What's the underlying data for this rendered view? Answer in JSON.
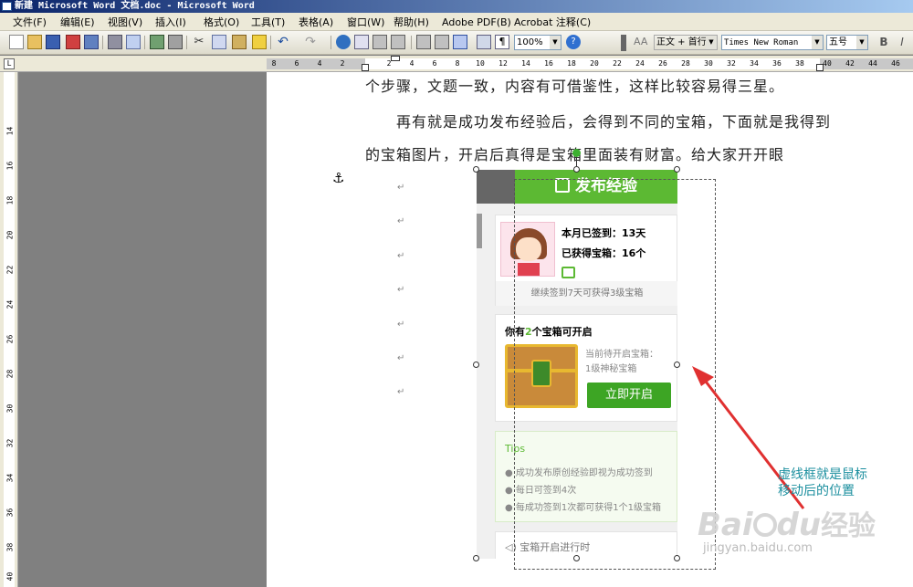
{
  "window": {
    "title": "新建 Microsoft Word 文档.doc - Microsoft Word"
  },
  "menu": {
    "items": [
      "文件(F)",
      "编辑(E)",
      "视图(V)",
      "插入(I)",
      "格式(O)",
      "工具(T)",
      "表格(A)",
      "窗口(W)",
      "帮助(H)",
      "Adobe PDF(B)",
      "Acrobat 注释(C)"
    ]
  },
  "toolbar": {
    "zoom": "100%",
    "style": "正文 + 首行",
    "font": "Times New Roman",
    "size": "五号",
    "bold": "B",
    "italic": "I"
  },
  "ruler": {
    "h_ticks": [
      "8",
      "6",
      "4",
      "2",
      "2",
      "4",
      "6",
      "8",
      "10",
      "12",
      "14",
      "16",
      "18",
      "20",
      "22",
      "24",
      "26",
      "28",
      "30",
      "32",
      "34",
      "36",
      "38",
      "40",
      "42",
      "44",
      "46"
    ],
    "v_ticks": [
      "14",
      "16",
      "18",
      "20",
      "22",
      "24",
      "26",
      "28",
      "30",
      "32",
      "34",
      "36",
      "38",
      "40"
    ]
  },
  "document": {
    "line1": "个步骤，文题一致，内容有可借鉴性，这样比较容易得三星。",
    "line2": "再有就是成功发布经验后，会得到不同的宝箱，下面就是我得到",
    "line3": "的宝箱图片，开启后真得是宝箱里面装有财富。给大家开开眼",
    "para_mark": "↵",
    "anchor": "⚓"
  },
  "picture": {
    "header": "发布经验",
    "signed_label": "本月已签到：",
    "signed_value": "13天",
    "chests_label": "已获得宝箱：",
    "chests_value": "16个",
    "continue_text": "继续签到7天可获得3级宝箱",
    "open_prefix": "你有",
    "open_count": "2",
    "open_suffix": "个宝箱可开启",
    "pending_label": "当前待开启宝箱：",
    "pending_value": "1级神秘宝箱",
    "open_button": "立即开启",
    "tips_title": "Tips",
    "tips": [
      "成功发布原创经验即视为成功签到",
      "每日可签到4次",
      "每成功签到1次都可获得1个1级宝箱"
    ],
    "progress_text": "宝箱开启进行时"
  },
  "annotation": {
    "line1": "虚线框就是鼠标",
    "line2": "移动后的位置"
  },
  "watermark": {
    "brand": "Bai",
    "brand2": "du",
    "suffix": "经验",
    "url": "jingyan.baidu.com"
  },
  "colors": {
    "accent_green": "#5cb933",
    "annotation_teal": "#1a8e9e",
    "arrow_red": "#e03030"
  }
}
